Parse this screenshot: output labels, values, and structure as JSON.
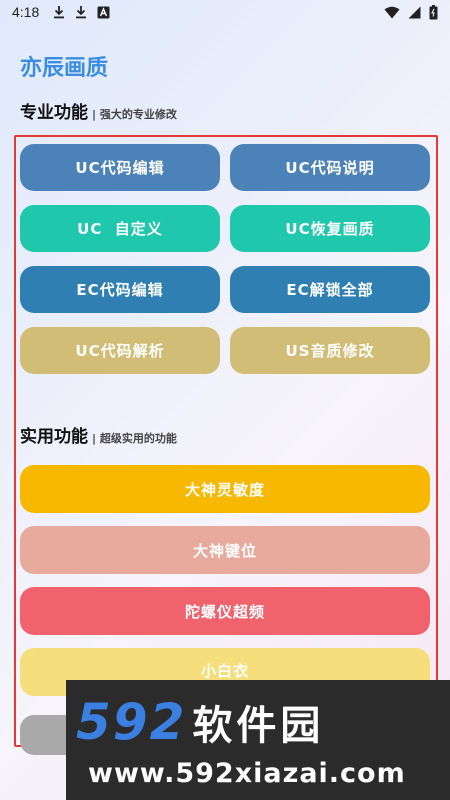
{
  "status_bar": {
    "time": "4:18",
    "left_icons": [
      "download-icon",
      "download-icon",
      "app-notification-icon"
    ],
    "right_icons": [
      "wifi-icon",
      "signal-icon",
      "battery-icon"
    ]
  },
  "app": {
    "title": "亦辰画质"
  },
  "pro_section": {
    "title": "专业功能",
    "subtitle": "| 强大的专业修改",
    "buttons": [
      {
        "label": "UC代码编辑",
        "color": "#4b83b8"
      },
      {
        "label": "UC代码说明",
        "color": "#4b83b8"
      },
      {
        "label": "UC  自定义",
        "color": "#1fc8ad"
      },
      {
        "label": "UC恢复画质",
        "color": "#1fc8ad"
      },
      {
        "label": "EC代码编辑",
        "color": "#2f7fb3"
      },
      {
        "label": "EC解锁全部",
        "color": "#2f7fb3"
      },
      {
        "label": "UC代码解析",
        "color": "#d2bd76"
      },
      {
        "label": "US音质修改",
        "color": "#d2bd76"
      }
    ]
  },
  "util_section": {
    "title": "实用功能",
    "subtitle": "| 超级实用的功能",
    "buttons": [
      {
        "label": "大神灵敏度",
        "color": "#f9b800"
      },
      {
        "label": "大神键位",
        "color": "#e9aa9e"
      },
      {
        "label": "陀螺仪超频",
        "color": "#f0636d"
      },
      {
        "label": "小白衣",
        "color": "#f5df7d"
      },
      {
        "label": "",
        "color": "#a9a9a9"
      }
    ]
  },
  "highlight_color": "#e53935",
  "watermark": {
    "number": "592",
    "text": "软件园",
    "url": "www.592xiazai.com"
  }
}
